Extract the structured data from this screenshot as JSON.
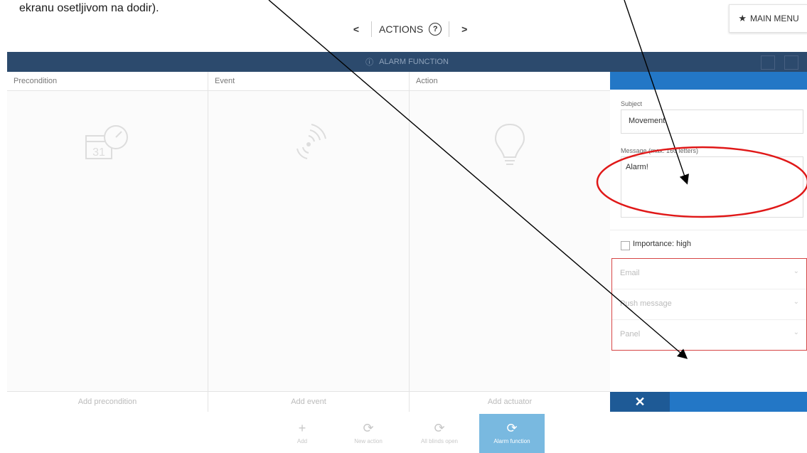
{
  "caption": "ekranu osetljivom na dodir).",
  "nav": {
    "prev": "<",
    "title": "ACTIONS",
    "help": "?",
    "next": ">"
  },
  "main_menu": {
    "icon": "star-icon",
    "label": "MAIN MENU"
  },
  "title_bar": {
    "title": "ALARM FUNCTION"
  },
  "columns": [
    {
      "header": "Precondition",
      "icon": "calendar-clock-icon",
      "icon_text": "31",
      "add_label": "Add precondition"
    },
    {
      "header": "Event",
      "icon": "signal-waves-icon",
      "add_label": "Add event"
    },
    {
      "header": "Action",
      "icon": "lightbulb-icon",
      "add_label": "Add actuator"
    }
  ],
  "panel": {
    "subject_label": "Subject",
    "subject_value": "Movement",
    "message_label": "Message (max. 160 letters)",
    "message_value": "Alarm!",
    "importance_label": "Importance: high",
    "importance_checked": false,
    "dropdowns": [
      {
        "label": "Email",
        "chevron": "⌄"
      },
      {
        "label": "Push message",
        "chevron": "⌄"
      },
      {
        "label": "Panel",
        "chevron": "⌄"
      }
    ],
    "close_icon": "close-icon",
    "close_glyph": "✕"
  },
  "toolbar": [
    {
      "label": "Add",
      "icon": "plus-icon",
      "glyph": "+",
      "active": false
    },
    {
      "label": "New action",
      "icon": "action-icon",
      "glyph": "⟳",
      "active": false
    },
    {
      "label": "All blinds open",
      "icon": "blinds-icon",
      "glyph": "⟳",
      "active": false
    },
    {
      "label": "Alarm function",
      "icon": "alarm-action-icon",
      "glyph": "⟳",
      "active": true
    }
  ],
  "colors": {
    "title_bar": "#2c4a6d",
    "accent_blue": "#2377c6",
    "toolbar_active": "#79b9e0",
    "highlight_red": "#d64545",
    "annotation_red": "#e01818"
  }
}
